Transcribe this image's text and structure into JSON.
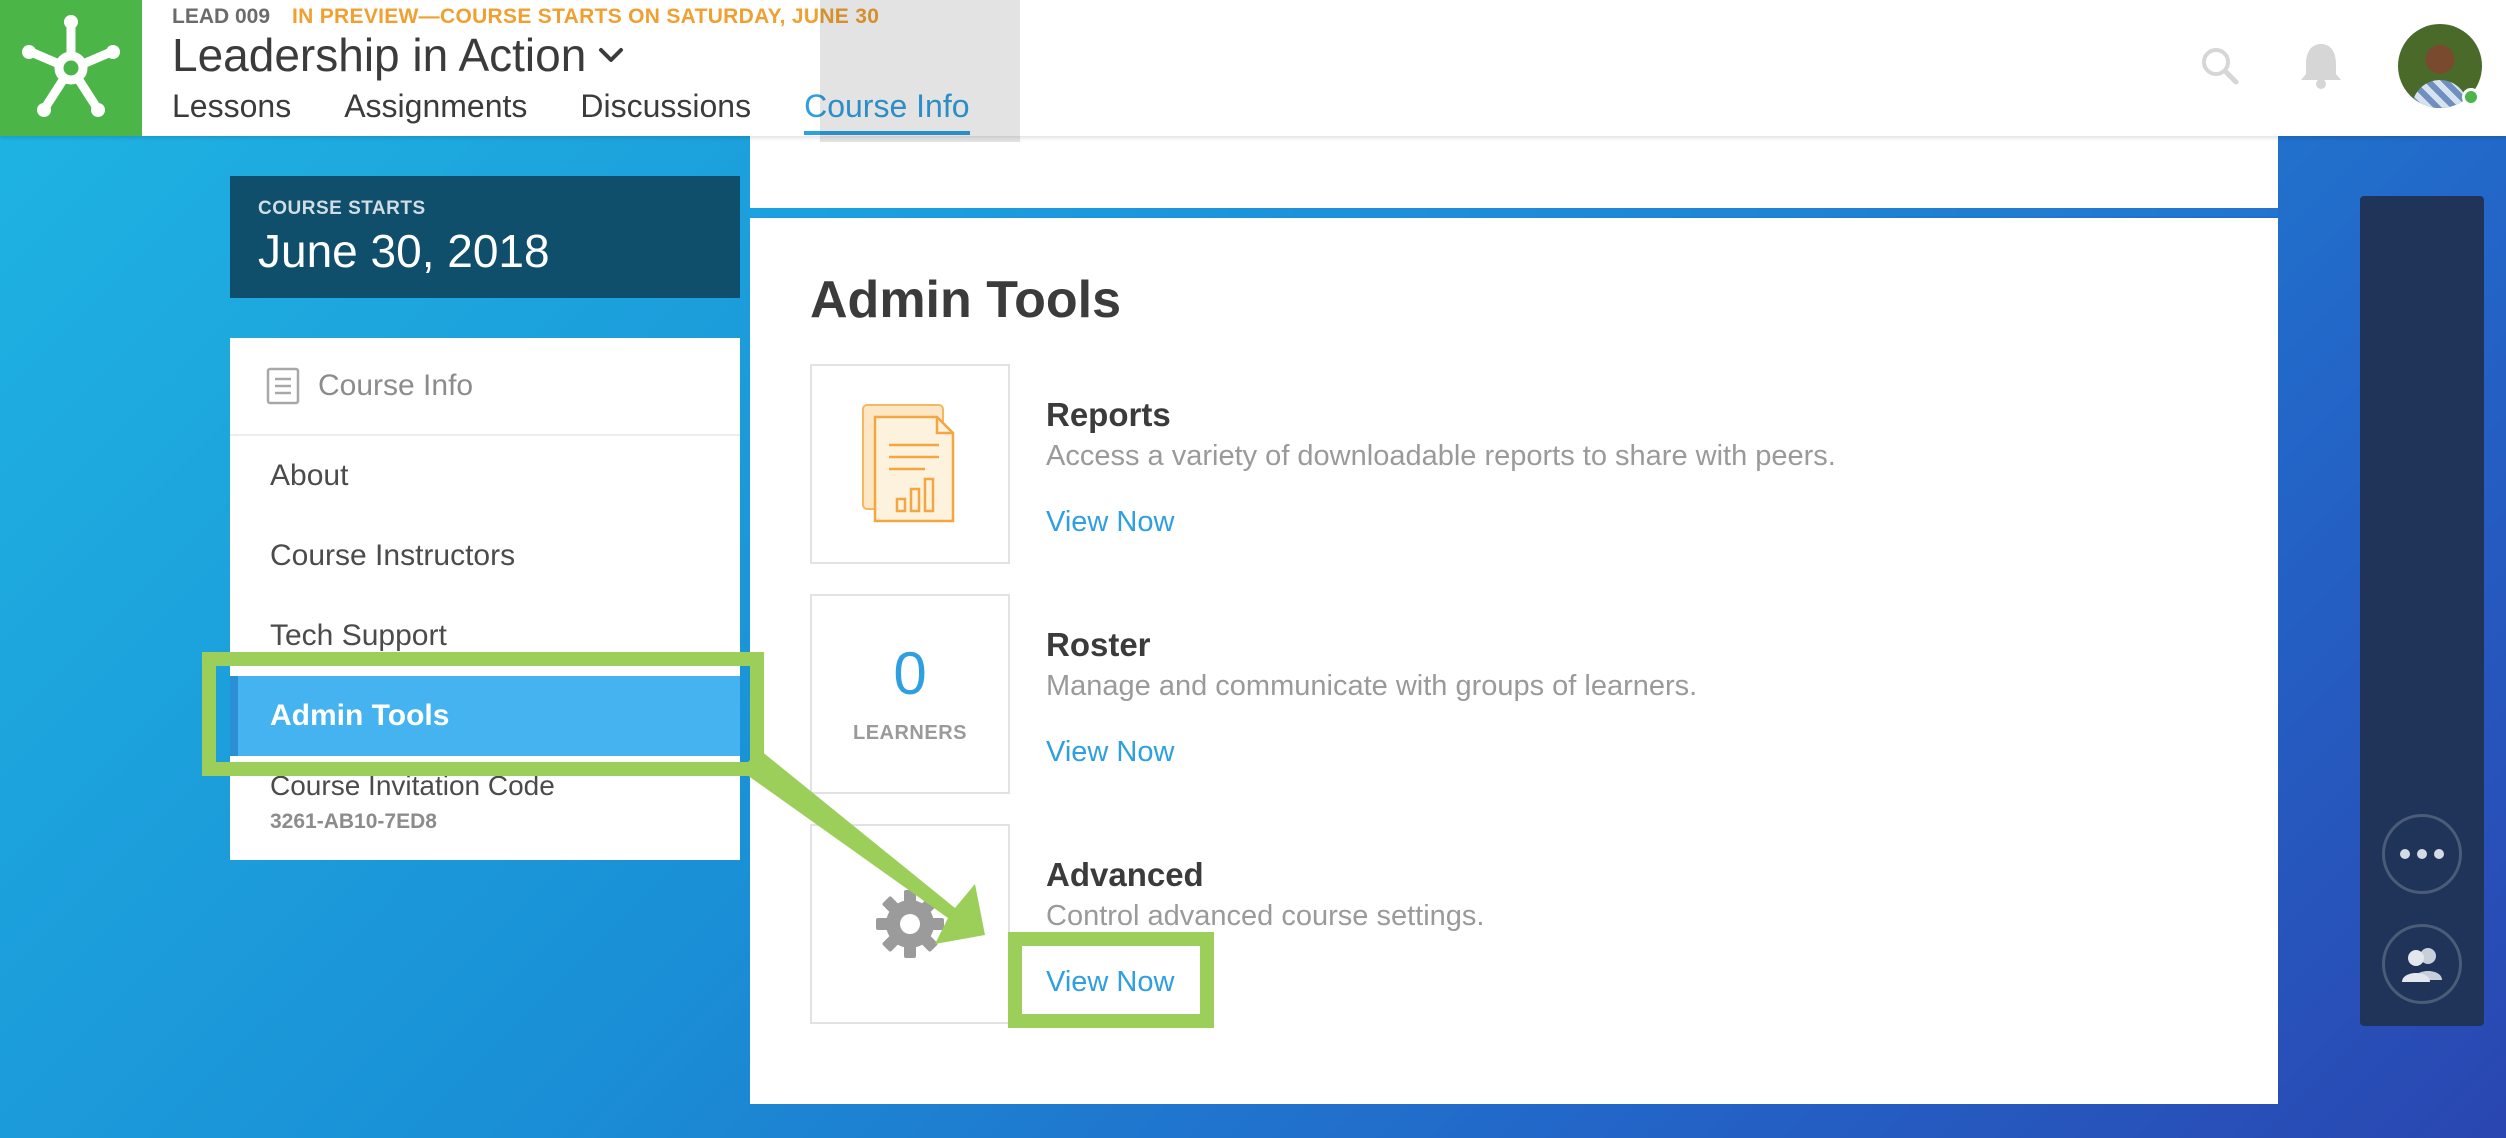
{
  "header": {
    "course_code": "LEAD 009",
    "preview_text": "IN PREVIEW—COURSE STARTS ON SATURDAY, JUNE 30",
    "course_title": "Leadership in Action",
    "tabs": [
      {
        "label": "Lessons",
        "active": false
      },
      {
        "label": "Assignments",
        "active": false
      },
      {
        "label": "Discussions",
        "active": false
      },
      {
        "label": "Course Info",
        "active": true
      }
    ]
  },
  "course_start": {
    "label": "COURSE STARTS",
    "date": "June 30, 2018"
  },
  "sidebar": {
    "heading": "Course Info",
    "items": [
      {
        "label": "About",
        "active": false
      },
      {
        "label": "Course Instructors",
        "active": false
      },
      {
        "label": "Tech Support",
        "active": false
      },
      {
        "label": "Admin Tools",
        "active": true
      }
    ],
    "invite": {
      "title": "Course Invitation Code",
      "code": "3261-AB10-7ED8"
    }
  },
  "main": {
    "title": "Admin Tools",
    "tools": [
      {
        "name": "Reports",
        "description": "Access a variety of downloadable reports to share with peers.",
        "link": "View Now",
        "icon": "report-document-icon"
      },
      {
        "name": "Roster",
        "description": "Manage and communicate with groups of learners.",
        "link": "View Now",
        "count": "0",
        "count_label": "LEARNERS"
      },
      {
        "name": "Advanced",
        "description": "Control advanced course settings.",
        "link": "View Now",
        "icon": "gear-icon"
      }
    ]
  },
  "icons": {
    "logo": "star-asterisk-logo",
    "search": "search-icon",
    "notifications": "bell-icon",
    "profile": "avatar",
    "rail_more": "more-dots-icon",
    "rail_people": "people-icon"
  },
  "colors": {
    "brand_green": "#4cb548",
    "accent_blue": "#2e9fe0",
    "preview_orange": "#f0a030",
    "start_box": "#0f4f6b",
    "active_item": "#45b3ef",
    "highlight_green": "#9ccf5a",
    "rail": "#1f3458"
  }
}
